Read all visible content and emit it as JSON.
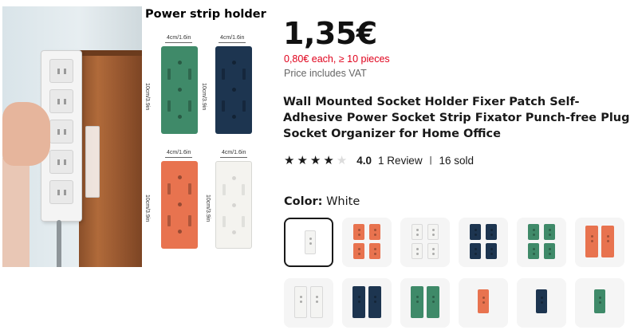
{
  "gallery": {
    "spec_title": "Power strip holder",
    "dimension_width": "4cm/1.6in",
    "dimension_height": "10cm/3.9in",
    "holder_colors": [
      "#3f8a69",
      "#1d3550",
      "#e8734f",
      "#f4f3ef"
    ]
  },
  "product": {
    "price": "1,35€",
    "bulk_price": "0,80€ each, ≥ 10 pieces",
    "vat_note": "Price includes VAT",
    "title": "Wall Mounted Socket Holder Fixer Patch Self-Adhesive Power Socket Strip Fixator Punch-free Plug Socket Organizer for Home Office",
    "rating": "4.0",
    "stars": 4,
    "reviews": "1 Review",
    "separator": "|",
    "sold": "16 sold"
  },
  "color_selector": {
    "label": "Color:",
    "selected": "White",
    "options": [
      {
        "name": "white-single",
        "colors": [
          "#f4f4f2"
        ],
        "count": 1
      },
      {
        "name": "orange-4",
        "colors": [
          "#e8734f",
          "#e8734f",
          "#e8734f",
          "#e8734f"
        ],
        "count": 4
      },
      {
        "name": "white-4",
        "colors": [
          "#f4f4f2",
          "#f4f4f2",
          "#f4f4f2",
          "#f4f4f2"
        ],
        "count": 4
      },
      {
        "name": "navy-4",
        "colors": [
          "#1d3550",
          "#1d3550",
          "#1d3550",
          "#1d3550"
        ],
        "count": 4
      },
      {
        "name": "green-4",
        "colors": [
          "#3f8a69",
          "#3f8a69",
          "#3f8a69",
          "#3f8a69"
        ],
        "count": 4
      },
      {
        "name": "orange-2",
        "colors": [
          "#e8734f",
          "#e8734f"
        ],
        "count": 2
      },
      {
        "name": "white-2",
        "colors": [
          "#f4f4f2",
          "#f4f4f2"
        ],
        "count": 2
      },
      {
        "name": "navy-2",
        "colors": [
          "#1d3550",
          "#1d3550"
        ],
        "count": 2
      },
      {
        "name": "green-2",
        "colors": [
          "#3f8a69",
          "#3f8a69"
        ],
        "count": 2
      },
      {
        "name": "orange-1",
        "colors": [
          "#e8734f"
        ],
        "count": 1
      },
      {
        "name": "navy-1",
        "colors": [
          "#1d3550"
        ],
        "count": 1
      },
      {
        "name": "green-1",
        "colors": [
          "#3f8a69"
        ],
        "count": 1
      }
    ]
  }
}
